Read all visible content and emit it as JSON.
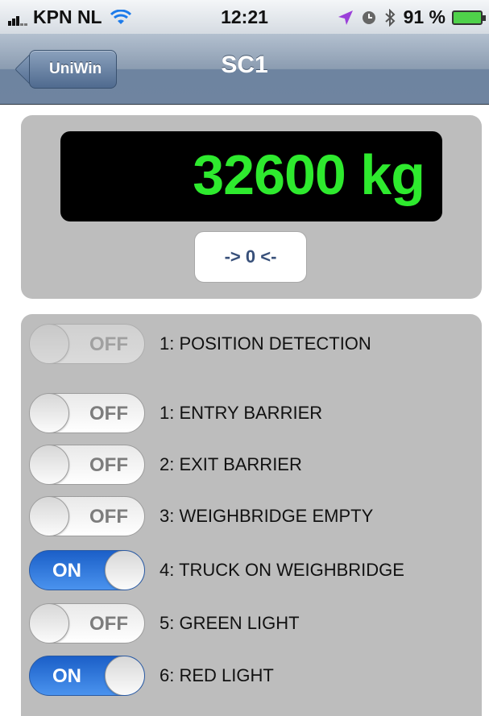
{
  "status_bar": {
    "carrier": "KPN NL",
    "time": "12:21",
    "battery_percent": "91 %"
  },
  "nav": {
    "back_label": "UniWin",
    "title": "SC1"
  },
  "scale": {
    "reading": "32600 kg",
    "zero_button_label": "-> 0 <-",
    "reading_color": "#2eea2e"
  },
  "signals": [
    {
      "state_label": "OFF",
      "text": "1: POSITION DETECTION",
      "on": false,
      "enabled": false
    },
    {
      "state_label": "OFF",
      "text": "1: ENTRY BARRIER",
      "on": false,
      "enabled": true
    },
    {
      "state_label": "OFF",
      "text": "2: EXIT BARRIER",
      "on": false,
      "enabled": true
    },
    {
      "state_label": "OFF",
      "text": "3: WEIGHBRIDGE EMPTY",
      "on": false,
      "enabled": true
    },
    {
      "state_label": "ON",
      "text": "4: TRUCK ON WEIGHBRIDGE",
      "on": true,
      "enabled": true
    },
    {
      "state_label": "OFF",
      "text": "5: GREEN LIGHT",
      "on": false,
      "enabled": true
    },
    {
      "state_label": "ON",
      "text": "6: RED LIGHT",
      "on": true,
      "enabled": true
    }
  ],
  "icons": {
    "signal": "cellular-signal-icon",
    "wifi": "wifi-icon",
    "location": "location-arrow-icon",
    "alarm": "alarm-clock-icon",
    "bluetooth": "bluetooth-icon",
    "battery": "battery-charging-icon"
  },
  "colors": {
    "switch_on": "#2a73dd",
    "nav_bar": "#7f93ad",
    "panel": "#bdbdbd"
  }
}
